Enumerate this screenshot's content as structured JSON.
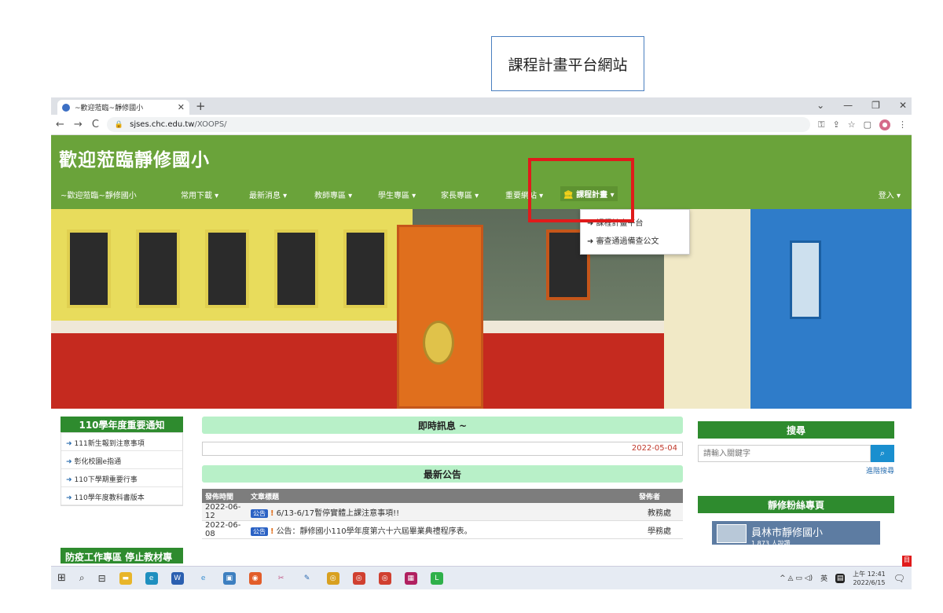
{
  "callout": {
    "text": "課程計畫平台網站"
  },
  "browser": {
    "tab_title": "~歡迎蒞臨~靜修國小",
    "url_domain": "sjses.chc.edu.tw",
    "url_path": "/XOOPS/"
  },
  "site": {
    "title": "歡迎蒞臨靜修國小",
    "nav": {
      "home": "~歡迎蒞臨~靜修國小",
      "items": [
        "常用下載 ▾",
        "最新消息 ▾",
        "教師專區 ▾",
        "學生專區 ▾",
        "家長專區 ▾",
        "重要網站 ▾"
      ],
      "active": "課程計畫 ▾",
      "login": "登入 ▾"
    },
    "dropdown": [
      "課程計畫平台",
      "審查通過備查公文"
    ]
  },
  "left_panel": {
    "title": "110學年度重要通知",
    "items": [
      "111新生報到注意事項",
      "彰化校園e指通",
      "110下學期重要行事",
      "110學年度教科書版本"
    ],
    "second_title": "防疫工作專區 停止教材專"
  },
  "middle": {
    "ticker_title": "即時訊息 ~",
    "ticker_date": "2022-05-04",
    "news_title": "最新公告",
    "columns": [
      "發佈時間",
      "文章標題",
      "發佈者"
    ],
    "rows": [
      {
        "date": "2022-06-12",
        "badge": "公告",
        "title": "6/13-6/17暫停實體上課注意事項!!",
        "author": "教務處"
      },
      {
        "date": "2022-06-08",
        "badge": "公告",
        "title": "公告：靜修國小110學年度第六十六屆畢業典禮程序表。",
        "author": "學務處"
      }
    ]
  },
  "right_panel": {
    "search_title": "搜尋",
    "search_placeholder": "請輸入關鍵字",
    "advanced": "進階搜尋",
    "fan_title": "靜修粉絲專頁",
    "fan_name": "員林市靜修國小",
    "fan_sub": "1,873 人說讚"
  },
  "taskbar": {
    "time": "上午 12:41",
    "date": "2022/6/15"
  }
}
